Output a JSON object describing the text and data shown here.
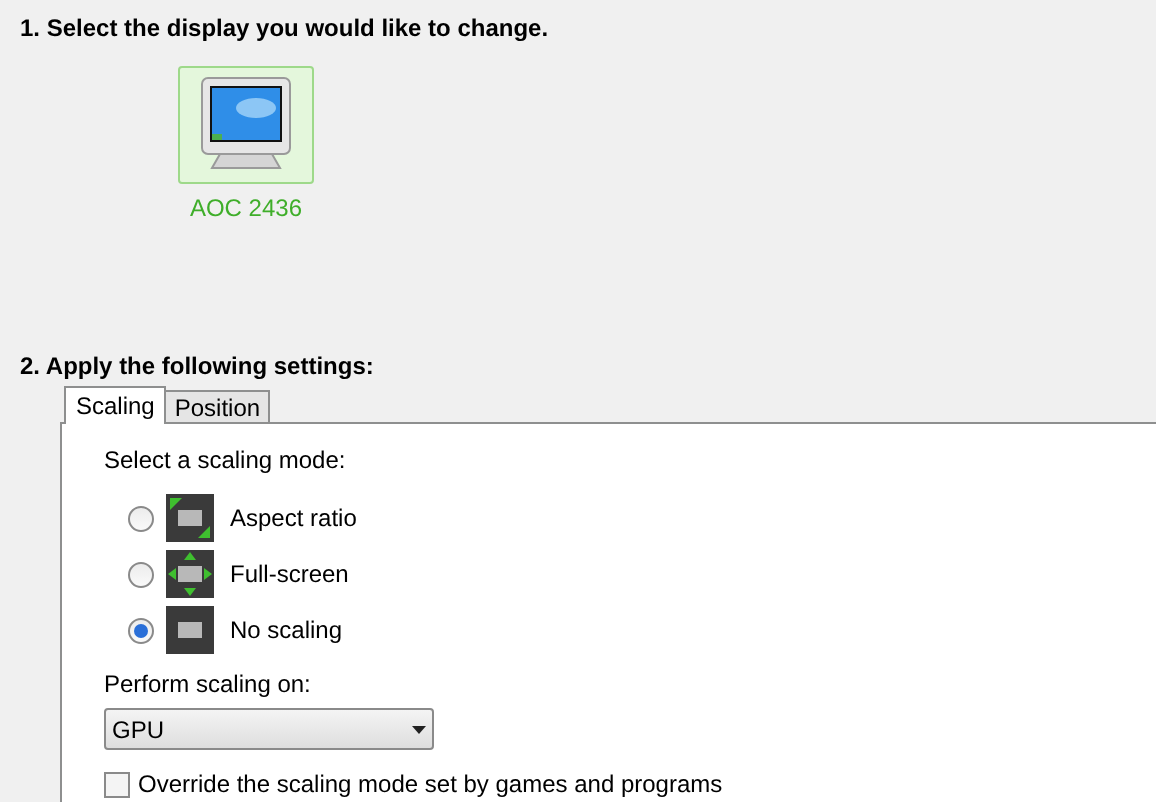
{
  "step1": {
    "heading": "1. Select the display you would like to change."
  },
  "displays": [
    {
      "label": "AOC 2436",
      "selected": true
    }
  ],
  "step2": {
    "heading": "2. Apply the following settings:"
  },
  "tabs": [
    {
      "label": "Scaling",
      "selected": true
    },
    {
      "label": "Position",
      "selected": false
    }
  ],
  "scaling": {
    "prompt": "Select a scaling mode:",
    "modes": [
      {
        "label": "Aspect ratio",
        "kind": "aspect",
        "selected": false
      },
      {
        "label": "Full-screen",
        "kind": "full",
        "selected": false
      },
      {
        "label": "No scaling",
        "kind": "none",
        "selected": true
      }
    ],
    "perform_label": "Perform scaling on:",
    "perform_value": "GPU",
    "override": {
      "label": "Override the scaling mode set by games and programs",
      "checked": false
    }
  }
}
